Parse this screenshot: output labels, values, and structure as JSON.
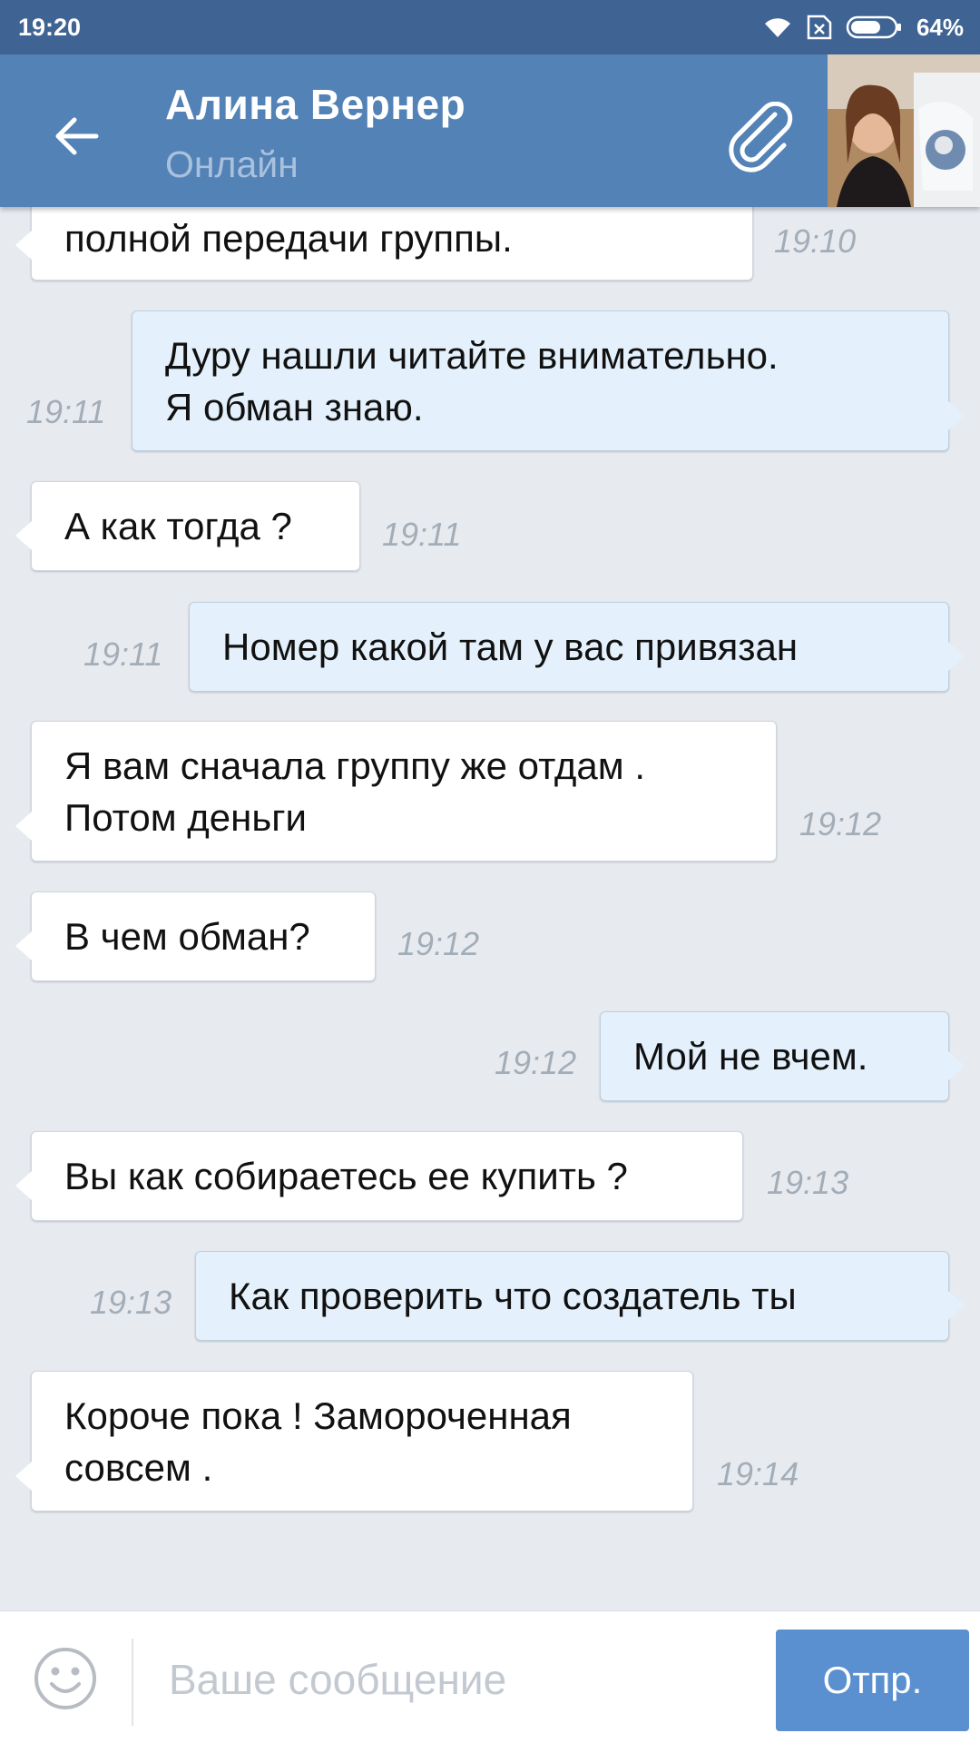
{
  "status_bar": {
    "time": "19:20",
    "battery_percent": "64%",
    "battery_level": 0.64,
    "icons": [
      "wifi-icon",
      "sim-none-icon",
      "battery-icon"
    ]
  },
  "header": {
    "back_icon": "arrow-left-icon",
    "contact_name": "Алина Вернер",
    "contact_status": "Онлайн",
    "attach_icon": "paperclip-icon"
  },
  "messages": [
    {
      "direction": "in",
      "lines": [
        "полной передачи группы."
      ],
      "time": "19:10"
    },
    {
      "direction": "out",
      "lines": [
        "Дуру  нашли читайте  внимательно.",
        "Я обман  знаю."
      ],
      "time": "19:11"
    },
    {
      "direction": "in",
      "lines": [
        "А как тогда ?"
      ],
      "time": "19:11"
    },
    {
      "direction": "out",
      "lines": [
        "Номер  какой  там у вас привязан"
      ],
      "time": "19:11"
    },
    {
      "direction": "in",
      "lines": [
        "Я вам сначала группу же отдам .",
        "Потом деньги"
      ],
      "time": "19:12"
    },
    {
      "direction": "in",
      "lines": [
        "В чем обман?"
      ],
      "time": "19:12"
    },
    {
      "direction": "out",
      "lines": [
        "Мой  не вчем."
      ],
      "time": "19:12"
    },
    {
      "direction": "in",
      "lines": [
        "Вы как собираетесь ее купить ?"
      ],
      "time": "19:13"
    },
    {
      "direction": "out",
      "lines": [
        "Как проверить  что  создатель ты"
      ],
      "time": "19:13"
    },
    {
      "direction": "in",
      "lines": [
        "Короче пока ! Замороченная",
        "совсем ."
      ],
      "time": "19:14"
    }
  ],
  "input_bar": {
    "emoji_icon": "smiley-icon",
    "placeholder": "Ваше сообщение",
    "value": "",
    "send_label": "Отпр."
  },
  "colors": {
    "header": "#5382b6",
    "status_bar": "#3f6494",
    "chat_background": "#e7ebf0",
    "incoming_bubble": "#ffffff",
    "outgoing_bubble": "#e4f1fc",
    "send_button": "#5a8fd0"
  }
}
